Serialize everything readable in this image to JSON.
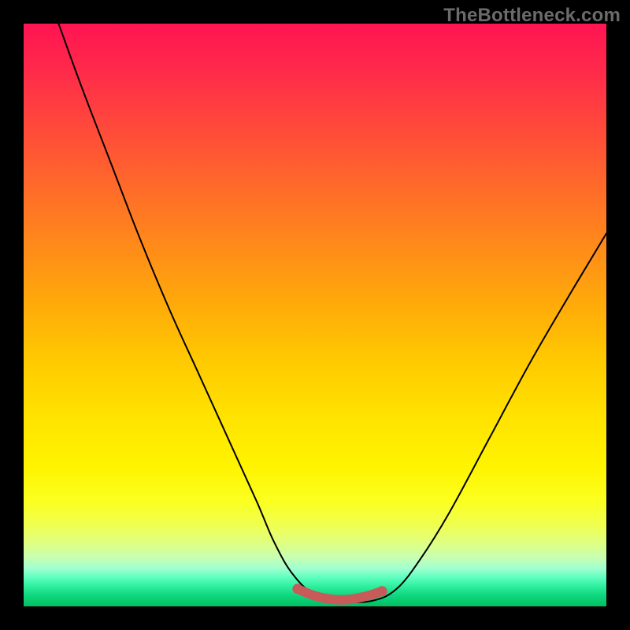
{
  "watermark": "TheBottleneck.com",
  "chart_data": {
    "type": "line",
    "title": "",
    "xlabel": "",
    "ylabel": "",
    "xlim": [
      0,
      1
    ],
    "ylim": [
      0,
      1
    ],
    "series": [
      {
        "name": "curve",
        "color": "#000000",
        "x": [
          0.06,
          0.1,
          0.15,
          0.2,
          0.25,
          0.3,
          0.35,
          0.4,
          0.43,
          0.462,
          0.5,
          0.55,
          0.6,
          0.64,
          0.68,
          0.73,
          0.8,
          0.87,
          0.94,
          1.0
        ],
        "y": [
          1.0,
          0.89,
          0.76,
          0.63,
          0.51,
          0.4,
          0.29,
          0.18,
          0.11,
          0.055,
          0.02,
          0.008,
          0.01,
          0.03,
          0.08,
          0.16,
          0.29,
          0.42,
          0.54,
          0.64
        ]
      },
      {
        "name": "bottom-highlight",
        "color": "#c85a5a",
        "x": [
          0.47,
          0.5,
          0.53,
          0.56,
          0.59,
          0.615
        ],
        "y": [
          0.03,
          0.018,
          0.012,
          0.012,
          0.018,
          0.026
        ]
      }
    ]
  }
}
